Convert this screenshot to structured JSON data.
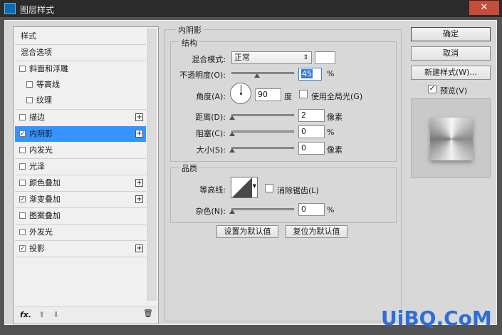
{
  "window": {
    "title": "图层样式",
    "close_glyph": "✕"
  },
  "left_panel": {
    "items": [
      {
        "label": "样式",
        "checkbox": false,
        "checked": false,
        "plus": false,
        "indent": false
      },
      {
        "label": "混合选项",
        "checkbox": false,
        "checked": false,
        "plus": false,
        "indent": false
      },
      {
        "label": "斜面和浮雕",
        "checkbox": true,
        "checked": false,
        "plus": false,
        "indent": false
      },
      {
        "label": "等高线",
        "checkbox": true,
        "checked": false,
        "plus": false,
        "indent": true
      },
      {
        "label": "纹理",
        "checkbox": true,
        "checked": false,
        "plus": false,
        "indent": true
      },
      {
        "label": "描边",
        "checkbox": true,
        "checked": false,
        "plus": true,
        "indent": false
      },
      {
        "label": "内阴影",
        "checkbox": true,
        "checked": true,
        "plus": true,
        "indent": false,
        "active": true
      },
      {
        "label": "内发光",
        "checkbox": true,
        "checked": false,
        "plus": false,
        "indent": false
      },
      {
        "label": "光泽",
        "checkbox": true,
        "checked": false,
        "plus": false,
        "indent": false
      },
      {
        "label": "颜色叠加",
        "checkbox": true,
        "checked": false,
        "plus": true,
        "indent": false
      },
      {
        "label": "渐变叠加",
        "checkbox": true,
        "checked": true,
        "plus": true,
        "indent": false
      },
      {
        "label": "图案叠加",
        "checkbox": true,
        "checked": false,
        "plus": false,
        "indent": false
      },
      {
        "label": "外发光",
        "checkbox": true,
        "checked": false,
        "plus": false,
        "indent": false
      },
      {
        "label": "投影",
        "checkbox": true,
        "checked": true,
        "plus": true,
        "indent": false
      }
    ],
    "footer": {
      "fx": "fx.",
      "up": "⬆",
      "down": "⬇",
      "trash": "🗑"
    }
  },
  "inner_shadow": {
    "section_title": "内阴影",
    "structure": {
      "title": "结构",
      "blend_mode_label": "混合模式:",
      "blend_mode_value": "正常",
      "opacity_label": "不透明度(O):",
      "opacity_value": "45",
      "opacity_unit": "%",
      "opacity_level": 0.45,
      "angle_label": "角度(A):",
      "angle_value": "90",
      "angle_unit": "度",
      "global_light_label": "使用全局光(G)",
      "global_light_checked": false,
      "distance_label": "距离(D):",
      "distance_value": "2",
      "distance_unit": "像素",
      "choke_label": "阻塞(C):",
      "choke_value": "0",
      "choke_unit": "%",
      "size_label": "大小(S):",
      "size_value": "0",
      "size_unit": "像素"
    },
    "quality": {
      "title": "品质",
      "contour_label": "等高线:",
      "antialias_label": "消除锯齿(L)",
      "antialias_checked": false,
      "noise_label": "杂色(N):",
      "noise_value": "0",
      "noise_unit": "%"
    },
    "make_default": "设置为默认值",
    "reset_default": "复位为默认值"
  },
  "right_panel": {
    "ok": "确定",
    "cancel": "取消",
    "new_style": "新建样式(W)...",
    "preview_label": "预览(V)",
    "preview_checked": true
  },
  "watermark": "UiBQ.CoM",
  "colors": {
    "accent": "#3594ff",
    "watermark": "#2d6fd6",
    "close": "#c74b3a"
  }
}
